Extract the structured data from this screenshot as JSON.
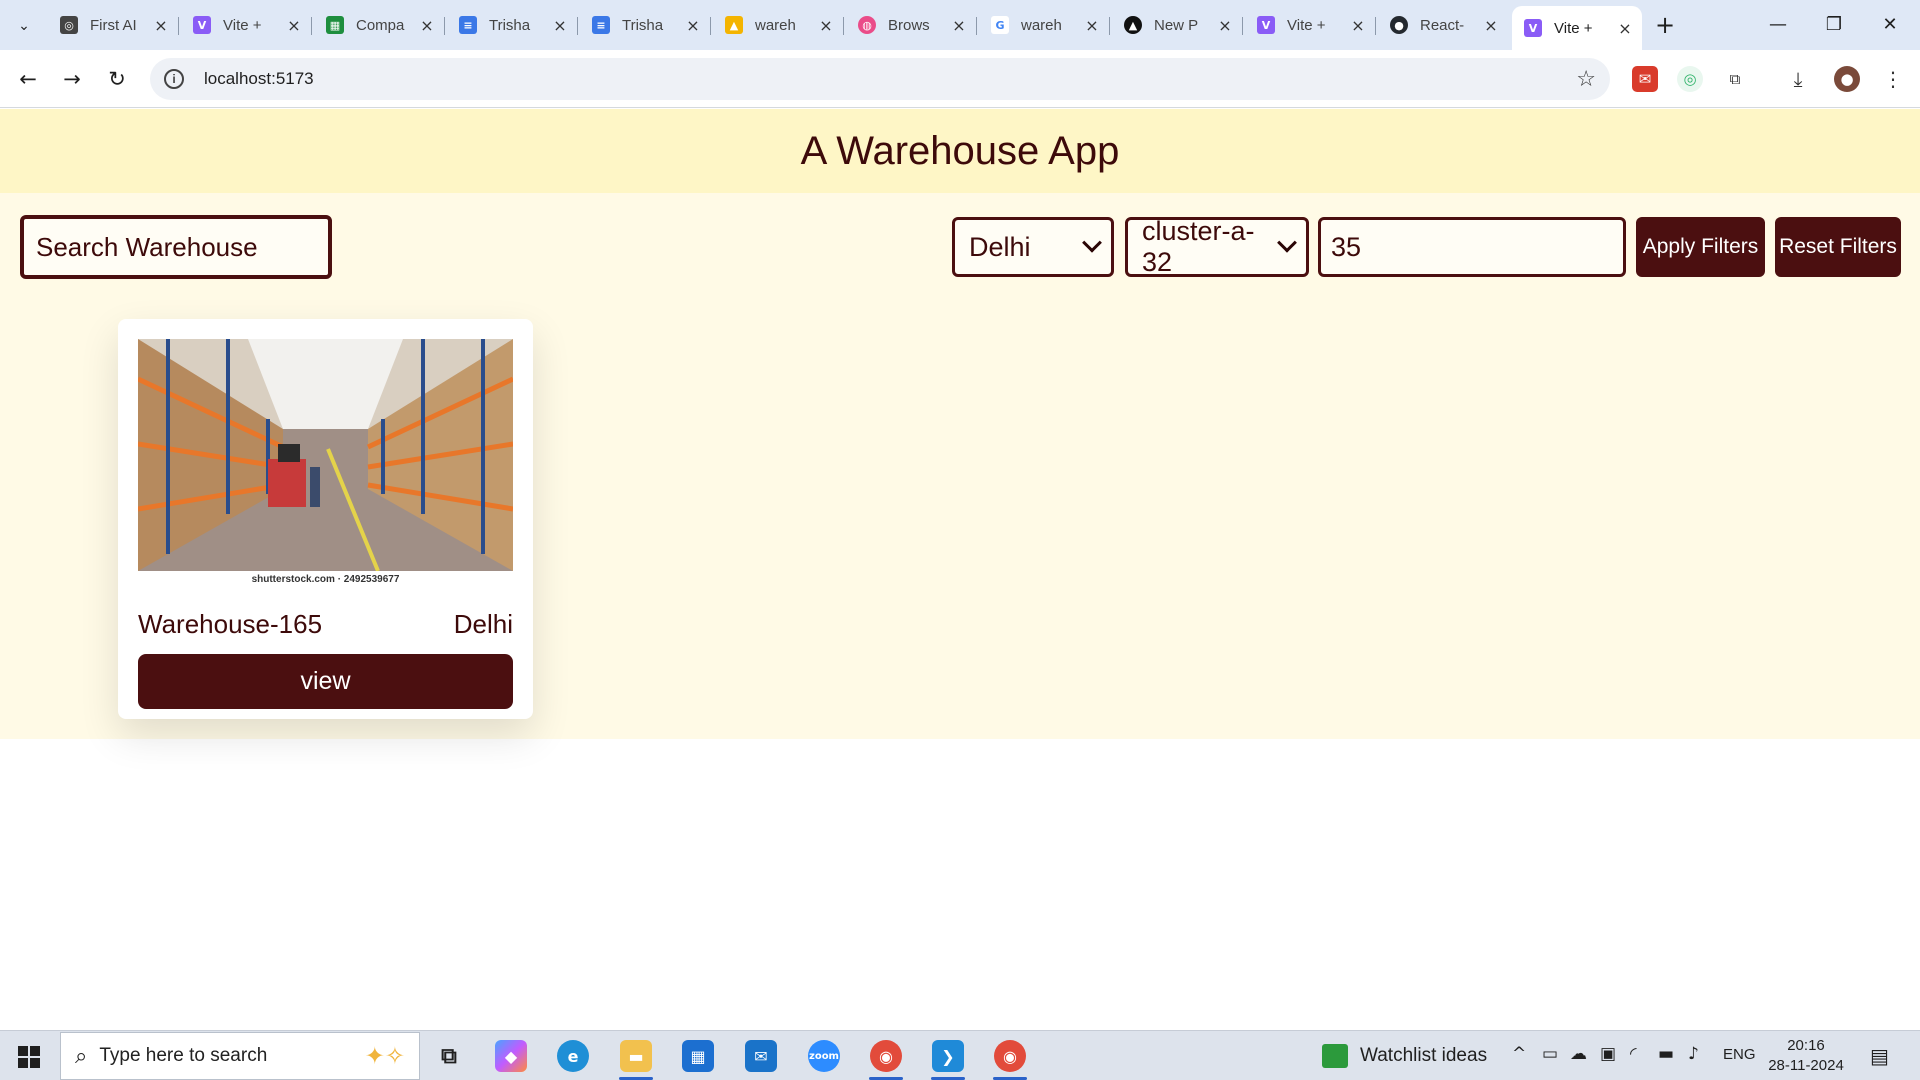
{
  "browser": {
    "tabs": [
      {
        "title": "First AI",
        "favicon": "chatgpt-icon",
        "color": "#444444"
      },
      {
        "title": "Vite +",
        "favicon": "vite-icon",
        "color": "#8a5cf6"
      },
      {
        "title": "Compa",
        "favicon": "sheets-icon",
        "color": "#1e8e3e"
      },
      {
        "title": "Trisha",
        "favicon": "docs-icon",
        "color": "#3b78e7"
      },
      {
        "title": "Trisha",
        "favicon": "docs-icon",
        "color": "#3b78e7"
      },
      {
        "title": "wareh",
        "favicon": "drive-icon",
        "color": "#f4b400"
      },
      {
        "title": "Brows",
        "favicon": "dribbble-icon",
        "color": "#ea4c89"
      },
      {
        "title": "wareh",
        "favicon": "google-icon",
        "color": "#4285f4"
      },
      {
        "title": "New P",
        "favicon": "notion-icon",
        "color": "#111111"
      },
      {
        "title": "Vite +",
        "favicon": "vite-icon",
        "color": "#8a5cf6"
      },
      {
        "title": "React-",
        "favicon": "github-icon",
        "color": "#24292f"
      },
      {
        "title": "Vite +",
        "favicon": "vite-icon",
        "color": "#8a5cf6"
      }
    ],
    "url": "localhost:5173"
  },
  "app": {
    "title": "A Warehouse App",
    "search_placeholder": "Search Warehouse",
    "city_select": "Delhi",
    "cluster_select": "cluster-a-32",
    "space_input": "35",
    "apply_label": "Apply Filters",
    "reset_label": "Reset Filters",
    "accent_color": "#4b0f10",
    "cards": [
      {
        "image_credit": "shutterstock.com · 2492539677",
        "name": "Warehouse-165",
        "city": "Delhi",
        "button_label": "view"
      }
    ]
  },
  "taskbar": {
    "search_placeholder": "Type here to search",
    "widget_label": "Watchlist ideas",
    "language": "ENG",
    "time": "20:16",
    "date": "28-11-2024"
  }
}
